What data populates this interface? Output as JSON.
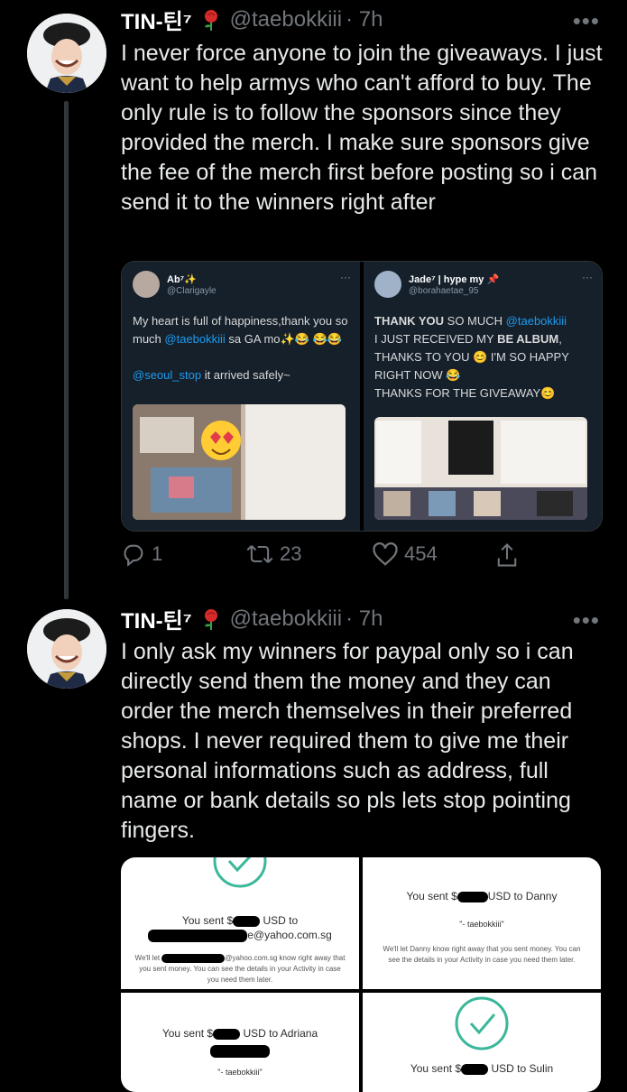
{
  "tweets": [
    {
      "name": "TIN-틴⁷",
      "handle": "@taebokkiii",
      "time": "· 7h",
      "more": "•••",
      "text": "I never force anyone to join the giveaways. I just want to help armys who can't afford to buy. The only rule is to follow the sponsors since they provided the merch. I make sure sponsors give the fee of the merch first before posting so i can send it to the winners right after",
      "embeds": [
        {
          "name": "Ab⁷✨",
          "handle": "@Clarigayle",
          "dots": "···",
          "line1_pre": "My heart is full of happiness,thank you so much ",
          "line1_mention": "@taebokkiii",
          "line1_post": " sa GA mo✨😂 😂😂",
          "line2_mention": "@seoul_stop",
          "line2_post": " it arrived safely~"
        },
        {
          "name": "Jade⁷ | hype my 📌",
          "handle": "@borahaetae_95",
          "dots": "···",
          "line1_pre": "THANK YOU",
          "line1_mid": " SO MUCH ",
          "line1_mention": "@taebokkiii",
          "line2": "I JUST RECEIVED MY ",
          "line2_bold": "BE ALBUM",
          "line3": ", THANKS TO YOU 😊 I'M SO HAPPY RIGHT NOW 😂",
          "line4": "THANKS FOR THE GIVEAWAY😊"
        }
      ],
      "replies": "1",
      "retweets": "23",
      "likes": "454"
    },
    {
      "name": "TIN-틴⁷",
      "handle": "@taebokkiii",
      "time": "· 7h",
      "more": "•••",
      "text": "I only ask my winners for paypal only so i can directly send them the money and they can order the merch themselves in their preferred shops. I never required them to give me their personal informations such as address, full name or bank details so pls lets stop pointing fingers."
    }
  ],
  "payments": {
    "p1_sent": "You sent $",
    "p1_usd": " USD to",
    "p1_email": "e@yahoo.com.sg",
    "p1_note": "We'll let",
    "p1_note2": "@yahoo.com.sg know right away that you sent money. You can see the details in your Activity in case you need them later.",
    "p2_sent": "You sent $",
    "p2_usd": "USD to Danny",
    "p2_quote": "\"- taebokkiii\"",
    "p2_note": "We'll let Danny know right away that you sent money. You can see the details in your Activity in case you need them later.",
    "p3_sent": "You sent $",
    "p3_usd": " USD to Adriana",
    "p3_quote": "\"- taebokkiii\"",
    "p4_sent": "You sent $",
    "p4_usd": " USD to Sulin"
  },
  "colors": {
    "background": "#000000",
    "accent": "#1d9bf0",
    "muted": "#71767b",
    "paypal_green": "#3bb79a"
  },
  "icons": [
    "reply-icon",
    "retweet-icon",
    "like-icon",
    "share-icon",
    "rose-icon",
    "checkmark-circle-icon"
  ]
}
